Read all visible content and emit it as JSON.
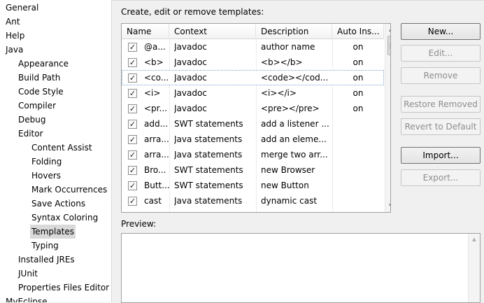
{
  "tree": {
    "items": [
      {
        "label": "General"
      },
      {
        "label": "Ant"
      },
      {
        "label": "Help"
      },
      {
        "label": "Java"
      },
      {
        "label": "Appearance"
      },
      {
        "label": "Build Path"
      },
      {
        "label": "Code Style"
      },
      {
        "label": "Compiler"
      },
      {
        "label": "Debug"
      },
      {
        "label": "Editor"
      },
      {
        "label": "Content Assist"
      },
      {
        "label": "Folding"
      },
      {
        "label": "Hovers"
      },
      {
        "label": "Mark Occurrences"
      },
      {
        "label": "Save Actions"
      },
      {
        "label": "Syntax Coloring"
      },
      {
        "label": "Templates"
      },
      {
        "label": "Typing"
      },
      {
        "label": "Installed JREs"
      },
      {
        "label": "JUnit"
      },
      {
        "label": "Properties Files Editor"
      },
      {
        "label": "MyEclipse"
      }
    ],
    "selected": "Templates"
  },
  "main": {
    "heading": "Create, edit or remove templates:",
    "preview_label": "Preview:"
  },
  "table": {
    "columns": [
      "Name",
      "Context",
      "Description",
      "Auto Ins..."
    ],
    "rows": [
      {
        "name": "@a...",
        "context": "Javadoc",
        "description": "author name",
        "auto": "on",
        "checked": true
      },
      {
        "name": "<b>",
        "context": "Javadoc",
        "description": "<b></b>",
        "auto": "on",
        "checked": true
      },
      {
        "name": "<co...",
        "context": "Javadoc",
        "description": "<code></cod...",
        "auto": "on",
        "checked": true
      },
      {
        "name": "<i>",
        "context": "Javadoc",
        "description": "<i></i>",
        "auto": "on",
        "checked": true
      },
      {
        "name": "<pr...",
        "context": "Javadoc",
        "description": "<pre></pre>",
        "auto": "on",
        "checked": true
      },
      {
        "name": "add...",
        "context": "SWT statements",
        "description": "add a listener ...",
        "auto": "",
        "checked": true
      },
      {
        "name": "arra...",
        "context": "Java statements",
        "description": "add an eleme...",
        "auto": "",
        "checked": true
      },
      {
        "name": "arra...",
        "context": "Java statements",
        "description": "merge two arr...",
        "auto": "",
        "checked": true
      },
      {
        "name": "Bro...",
        "context": "SWT statements",
        "description": "new Browser",
        "auto": "",
        "checked": true
      },
      {
        "name": "Butt...",
        "context": "SWT statements",
        "description": "new Button",
        "auto": "",
        "checked": true
      },
      {
        "name": "cast",
        "context": "Java statements",
        "description": "dynamic cast",
        "auto": "",
        "checked": true
      }
    ],
    "selected_row": 2
  },
  "buttons": {
    "new": "New...",
    "edit": "Edit...",
    "remove": "Remove",
    "restore_removed": "Restore Removed",
    "revert_to_default": "Revert to Default",
    "import": "Import...",
    "export": "Export..."
  }
}
